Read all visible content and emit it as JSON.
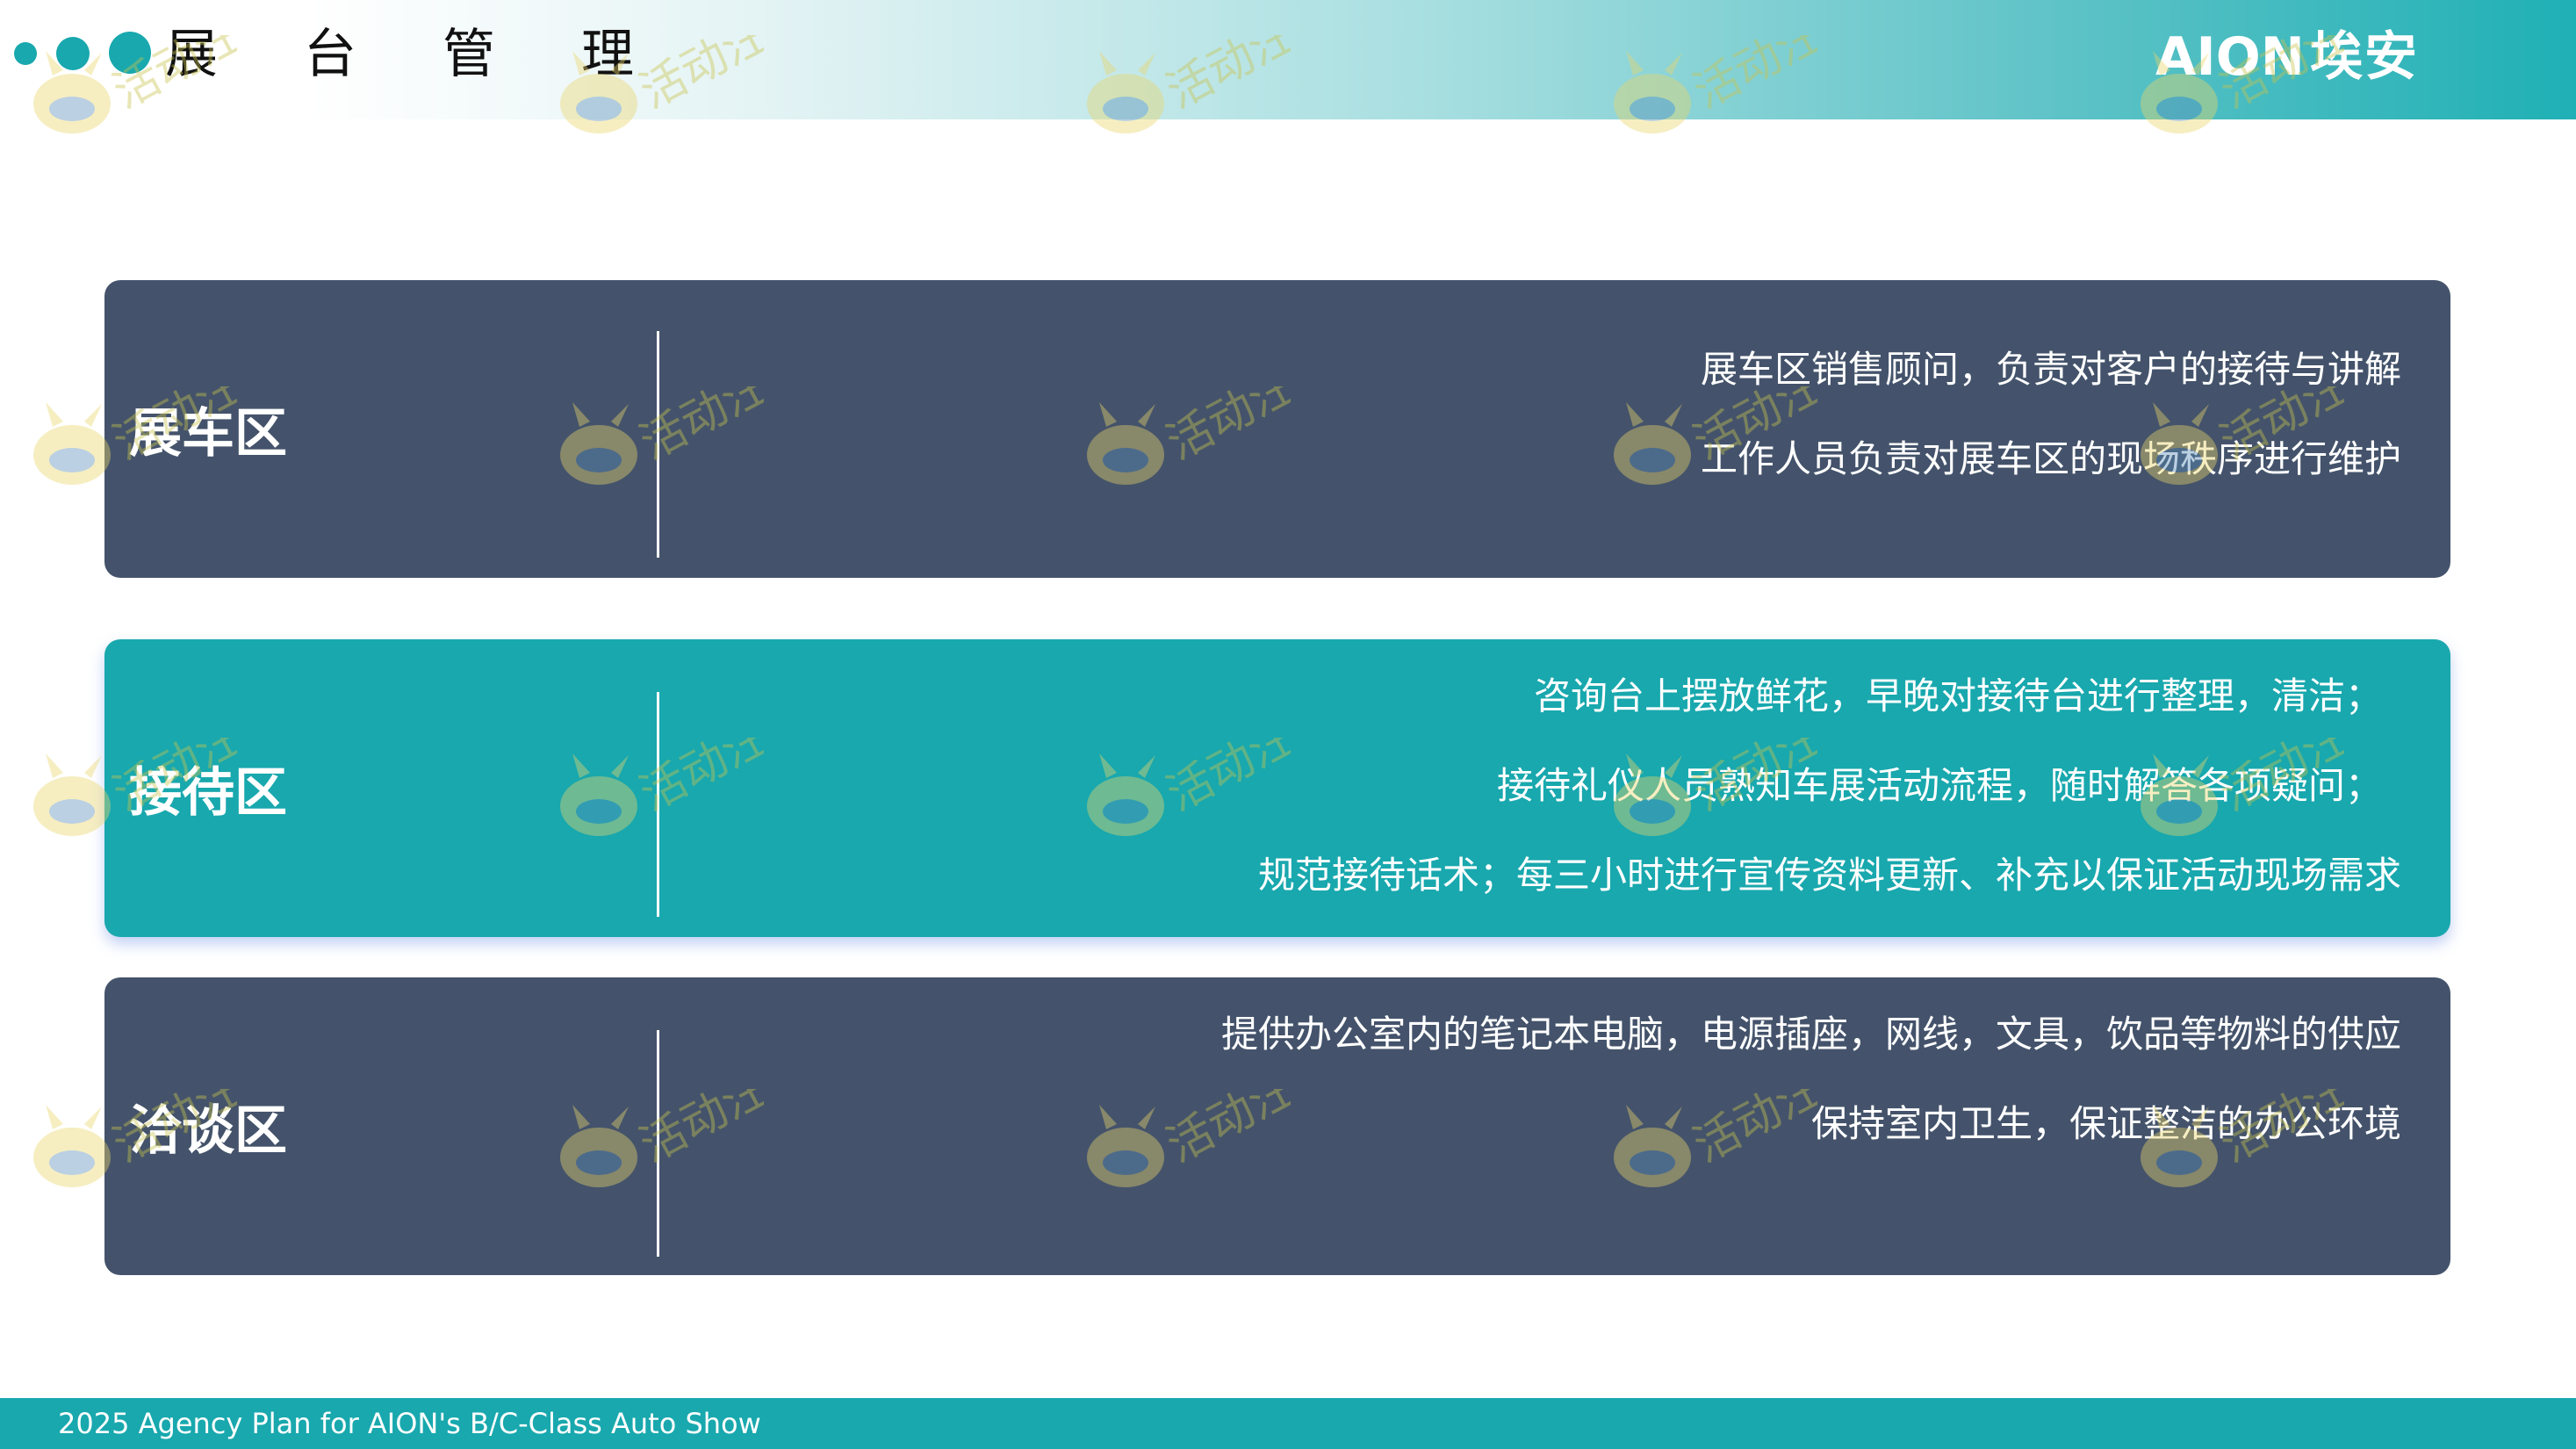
{
  "header": {
    "title": "展台管理",
    "logo": {
      "latin": "AION",
      "chinese": "埃安"
    }
  },
  "watermark": "活动汪",
  "panels": [
    {
      "label": "展车区",
      "lines": [
        "展车区销售顾问，负责对客户的接待与讲解",
        "工作人员负责对展车区的现场秩序进行维护"
      ]
    },
    {
      "label": "接待区",
      "lines": [
        "咨询台上摆放鲜花，早晚对接待台进行整理，清洁；",
        "接待礼仪人员熟知车展活动流程，随时解答各项疑问；",
        "规范接待话术；每三小时进行宣传资料更新、补充以保证活动现场需求"
      ]
    },
    {
      "label": "洽谈区",
      "lines": [
        "提供办公室内的笔记本电脑，电源插座，网线，文具，饮品等物料的供应",
        "保持室内卫生，保证整洁的办公环境"
      ]
    }
  ],
  "footer": {
    "text": "2025 Agency Plan for AION's B/C-Class Auto Show"
  },
  "colors": {
    "panel_dark": "#44536b",
    "panel_teal": "#18a8ae",
    "footer_bar": "#18a8ae",
    "dot_color": "#18a8ae"
  }
}
